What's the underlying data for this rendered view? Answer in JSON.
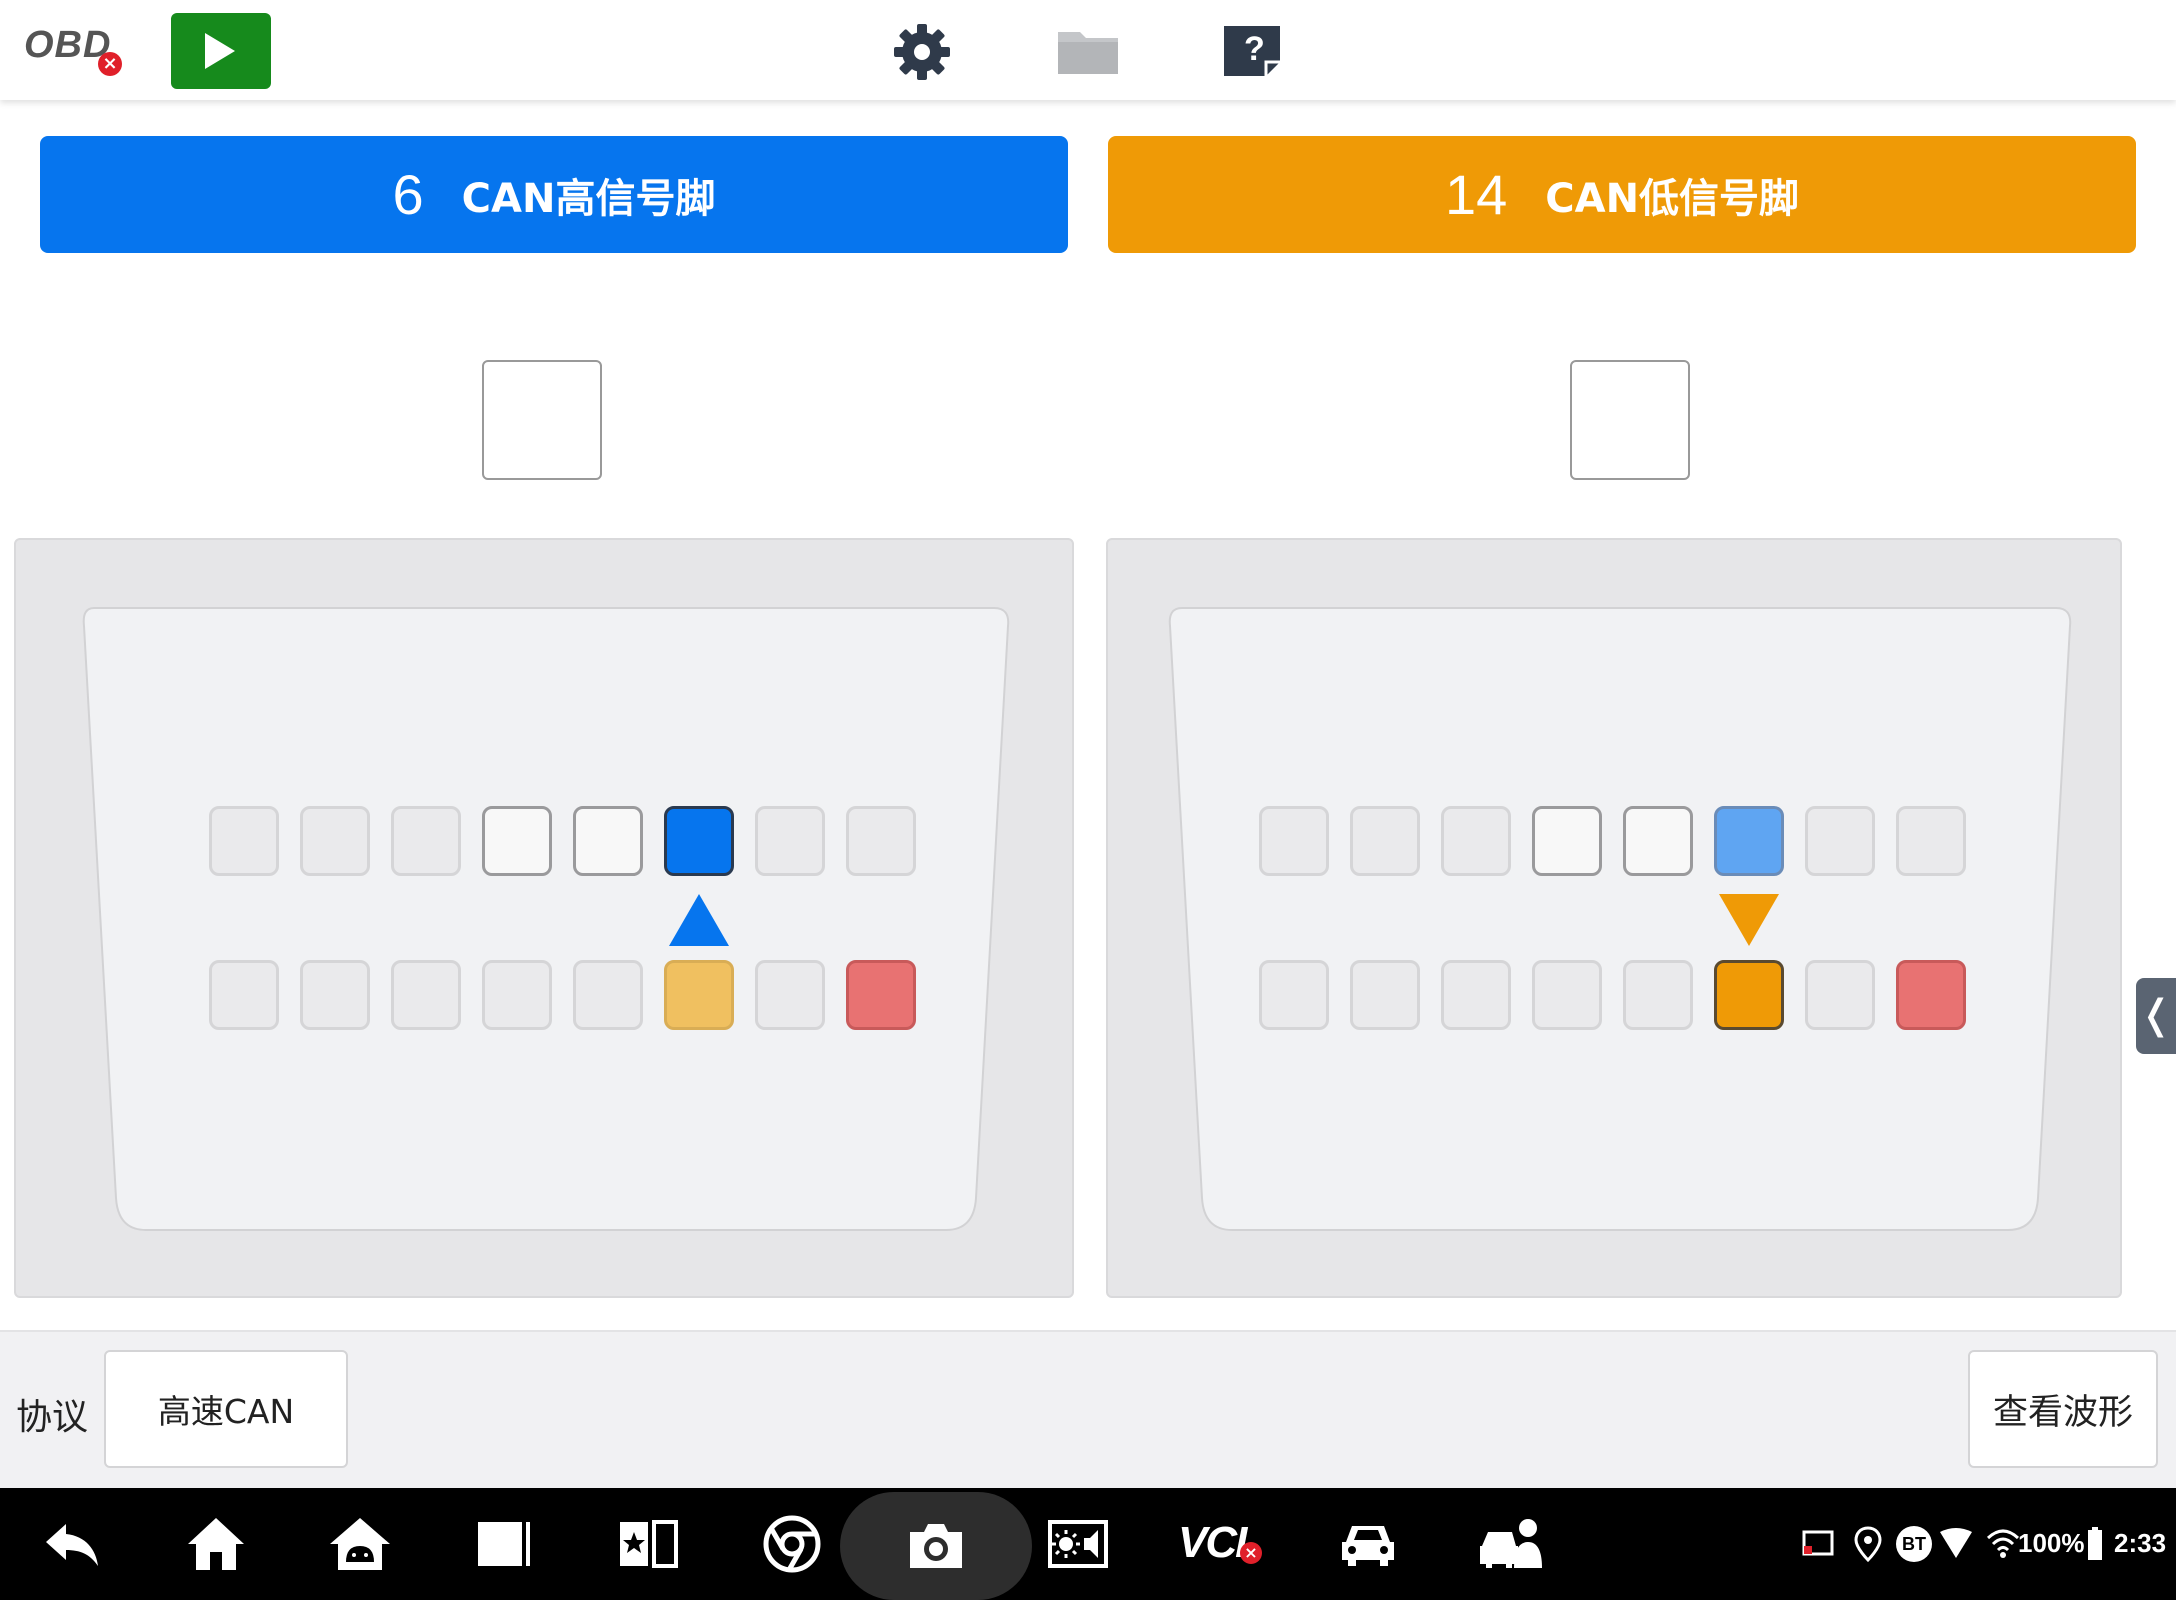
{
  "app": {
    "obd_label": "OBD",
    "obd_status_badge": "×"
  },
  "toolbar": {
    "icons": [
      "settings-gear-icon",
      "folder-icon",
      "help-icon"
    ]
  },
  "pins": {
    "high": {
      "number": "6",
      "name": "CAN高信号脚",
      "color": "#0675ee"
    },
    "low": {
      "number": "14",
      "name": "CAN低信号脚",
      "color": "#ef9a06"
    }
  },
  "protocol": {
    "label": "协议",
    "value": "高速CAN"
  },
  "waveform_button": "查看波形",
  "side_tab_glyph": "❬",
  "system_bar": {
    "vci": "VCI",
    "bt": "BT",
    "battery": "100%",
    "time": "2:33",
    "icons": [
      "back-icon",
      "home-icon",
      "android-home-icon",
      "recent-apps-icon",
      "favorites-icon",
      "chrome-icon",
      "camera-icon",
      "brightness-volume-icon",
      "vci-icon",
      "car-icon",
      "car-service-icon",
      "cast-icon",
      "location-icon",
      "bluetooth-icon",
      "wifi-icon",
      "battery-icon"
    ]
  }
}
